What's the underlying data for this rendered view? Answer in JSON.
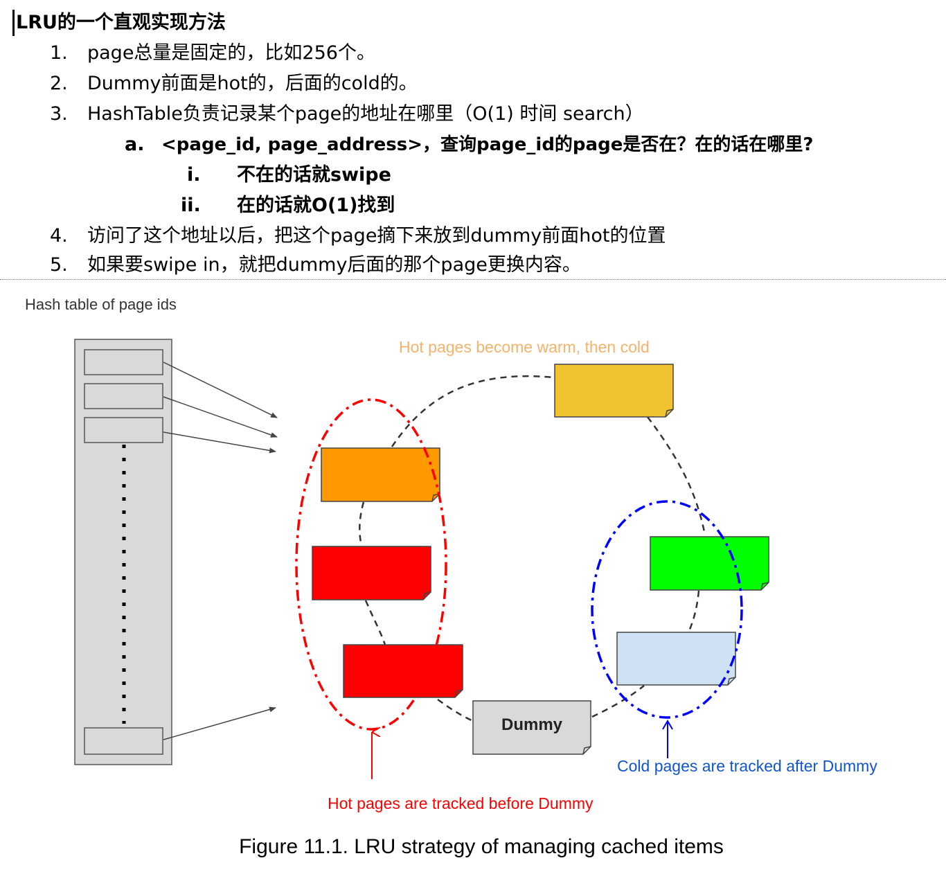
{
  "heading": "LRU的一个直观实现方法",
  "list": {
    "item1": {
      "num": "1.",
      "text": "page总量是固定的，比如256个。"
    },
    "item2": {
      "num": "2.",
      "text": "Dummy前面是hot的，后面的cold的。"
    },
    "item3": {
      "num": "3.",
      "text": "HashTable负责记录某个page的地址在哪里（O(1) 时间 search）"
    },
    "item3a": {
      "num": "a.",
      "text": "<page_id, page_address>，查询page_id的page是否在？在的话在哪里?"
    },
    "item3a_i": {
      "num": "i.",
      "text": "不在的话就swipe"
    },
    "item3a_ii": {
      "num": "ii.",
      "text": "在的话就O(1)找到"
    },
    "item4": {
      "num": "4.",
      "text": "访问了这个地址以后，把这个page摘下来放到dummy前面hot的位置"
    },
    "item5": {
      "num": "5.",
      "text": "如果要swipe in，就把dummy后面的那个page更换内容。"
    }
  },
  "diagram": {
    "hash_table_label": "Hash table of page ids",
    "warm_cold_label": "Hot pages become warm, then cold",
    "dummy_label": "Dummy",
    "cold_tracked_label": "Cold pages are tracked after Dummy",
    "hot_tracked_label": "Hot pages are tracked before Dummy",
    "colors": {
      "yellow_page": "#f1c232",
      "orange_page": "#ff9900",
      "red_page": "#ff0000",
      "green_page": "#00ff00",
      "light_blue_page": "#cfe2f3",
      "dummy_page": "#d9d9d9",
      "hot_accent": "#ff0000",
      "warm_accent": "#f6b26b",
      "cold_accent": "#0000ff",
      "cold_text": "#1155cc"
    }
  },
  "caption": "Figure 11.1. LRU strategy of managing cached items"
}
